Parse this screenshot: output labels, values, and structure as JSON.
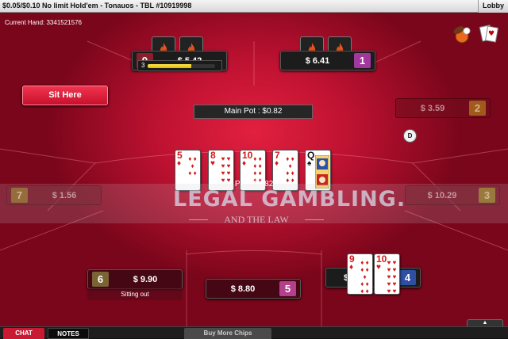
{
  "window": {
    "title": "$0.05/$0.10 No limit Hold'em - Tonauos - TBL #10919998",
    "lobby_label": "Lobby"
  },
  "table": {
    "current_hand": "Current Hand: 3341521576",
    "sit_here_label": "Sit Here",
    "main_pot": "Main Pot : $0.82",
    "total_pot": "Total Pot : $0.82",
    "dealer_label": "D",
    "timer_value": "3",
    "timer_fraction": 0.65,
    "sitting_out_label": "Sitting out"
  },
  "seats": [
    {
      "num": "9",
      "amount": "$ 5.42",
      "num_color": "#8a1f2b"
    },
    {
      "num": "1",
      "amount": "$ 6.41",
      "num_color": "#a2379c"
    },
    {
      "num": "2",
      "amount": "$ 3.59",
      "num_color": "#a05a1c"
    },
    {
      "num": "3",
      "amount": "$ 10.29",
      "num_color": "#8f6a1c"
    },
    {
      "num": "4",
      "amount": "$",
      "num_color": "#2f4fa2"
    },
    {
      "num": "5",
      "amount": "$ 8.80",
      "num_color": "#b43f8c"
    },
    {
      "num": "6",
      "amount": "$ 9.90",
      "num_color": "#7a6436"
    },
    {
      "num": "7",
      "amount": "$ 1.56",
      "num_color": "#8a5a1c"
    }
  ],
  "board": [
    {
      "rank": "5",
      "suit": "♦",
      "color": "red"
    },
    {
      "rank": "8",
      "suit": "♥",
      "color": "red"
    },
    {
      "rank": "10",
      "suit": "♦",
      "color": "red"
    },
    {
      "rank": "7",
      "suit": "♦",
      "color": "red"
    },
    {
      "rank": "Q",
      "suit": "♠",
      "color": "blk"
    }
  ],
  "player4_cards": [
    {
      "rank": "9",
      "suit": "♦",
      "color": "red"
    },
    {
      "rank": "10",
      "suit": "♥",
      "color": "red"
    }
  ],
  "watermark": {
    "main": "LEGAL GAMBLING.",
    "sub": "AND THE LAW"
  },
  "bottom": {
    "chat": "CHAT",
    "notes": "NOTES",
    "buy_more_chips": "Buy More Chips",
    "expand": "▲"
  },
  "colors": {
    "felt": "#c01232",
    "chat_tab": "#c81a33",
    "timer": "#ffe84a"
  }
}
